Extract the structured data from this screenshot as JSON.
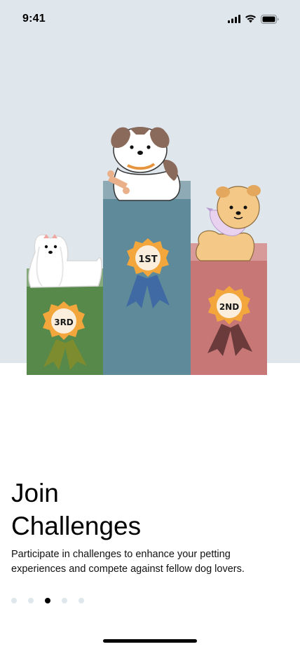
{
  "status_bar": {
    "time": "9:41",
    "icons": [
      "cellular-signal-icon",
      "wifi-icon",
      "battery-icon"
    ]
  },
  "illustration": {
    "podium_labels": {
      "first": "1ST",
      "second": "2ND",
      "third": "3RD"
    },
    "colors": {
      "background": "#dfe6ec",
      "first_block": "#5f8a99",
      "second_block": "#c87777",
      "third_block": "#56894a",
      "ribbon_badge": "#f2a63c"
    }
  },
  "onboarding": {
    "title_line1": "Join",
    "title_line2": "Challenges",
    "description": "Participate in challenges to enhance your petting experiences and compete against fellow dog lovers."
  },
  "pagination": {
    "total": 5,
    "active_index": 2
  }
}
